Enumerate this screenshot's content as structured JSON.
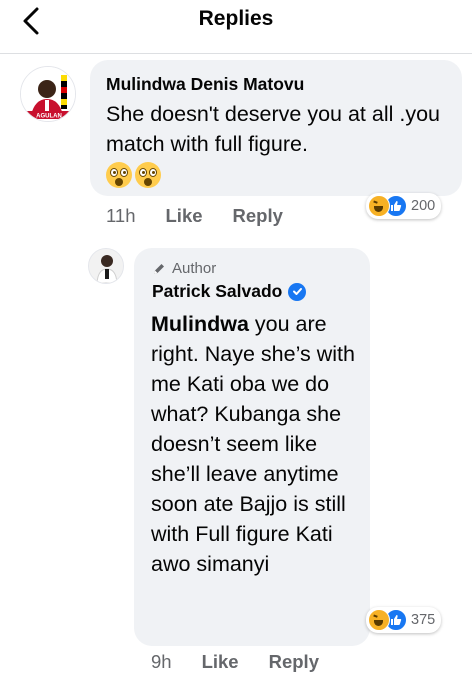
{
  "header": {
    "title": "Replies",
    "back_icon": "chevron-left-icon"
  },
  "comment": {
    "author": "Mulindwa Denis Matovu",
    "avatar_badge_text": "AGULAN",
    "text": "She doesn't deserve you at all .you match with full figure.",
    "emojis": [
      "astonished-face-emoji",
      "astonished-face-emoji"
    ],
    "time": "11h",
    "like_label": "Like",
    "reply_label": "Reply",
    "reactions": {
      "icons": [
        "haha-reaction-icon",
        "like-reaction-icon"
      ],
      "count": "200"
    }
  },
  "reply": {
    "badge": "Author",
    "badge_icon": "pencil-icon",
    "author": "Patrick Salvado",
    "verified_icon": "verified-badge-icon",
    "mention": "Mulindwa",
    "text": " you are right. Naye she’s with me Kati oba we do what? Kubanga she doesn’t seem like she’ll leave anytime soon ate Bajjo is still with Full figure Kati awo simanyi",
    "time": "9h",
    "like_label": "Like",
    "reply_label": "Reply",
    "reactions": {
      "icons": [
        "haha-reaction-icon",
        "like-reaction-icon"
      ],
      "count": "375"
    }
  },
  "colors": {
    "bubble": "#f0f2f5",
    "secondary_text": "#65676b",
    "facebook_blue": "#1877f2",
    "haha_yellow": "#f7b125"
  }
}
